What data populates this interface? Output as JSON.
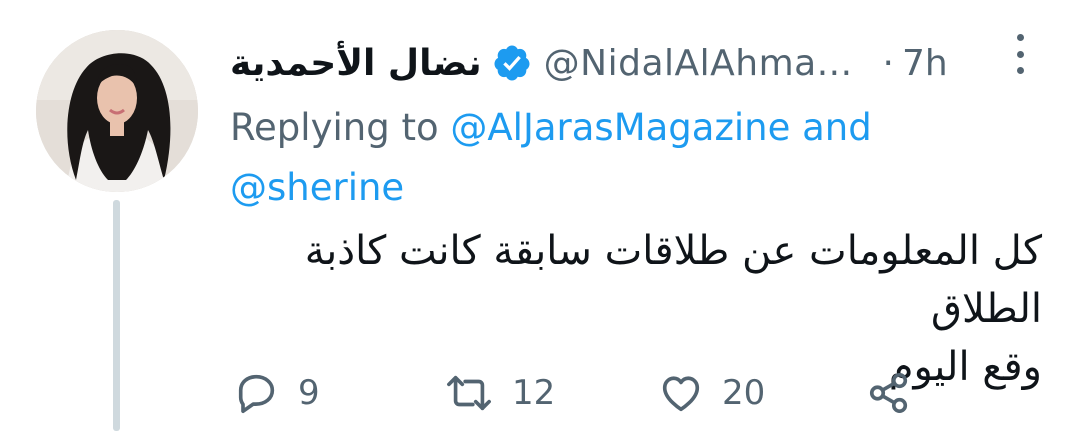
{
  "tweet": {
    "display_name": "نضال الأحمدية",
    "handle": "@NidalAlAhma...",
    "separator": "·",
    "time": "7h",
    "replying_prefix": "Replying to ",
    "replying_mention_1": "@AlJarasMagazine",
    "replying_and": " and",
    "replying_mention_2": "@sherine",
    "text_line_1": "كل المعلومات عن طلاقات سابقة كانت كاذبة الطلاق",
    "text_line_2": "وقع اليوم"
  },
  "actions": {
    "reply_count": "9",
    "retweet_count": "12",
    "like_count": "20"
  },
  "icons": {
    "verified": "verified-badge-icon",
    "more": "more-vertical-icon",
    "reply": "reply-icon",
    "retweet": "retweet-icon",
    "like": "heart-icon",
    "share": "share-icon"
  },
  "colors": {
    "accent": "#1d9bf0",
    "secondary_text": "#536471",
    "primary_text": "#0f1419",
    "thread_line": "#cfd9de"
  }
}
